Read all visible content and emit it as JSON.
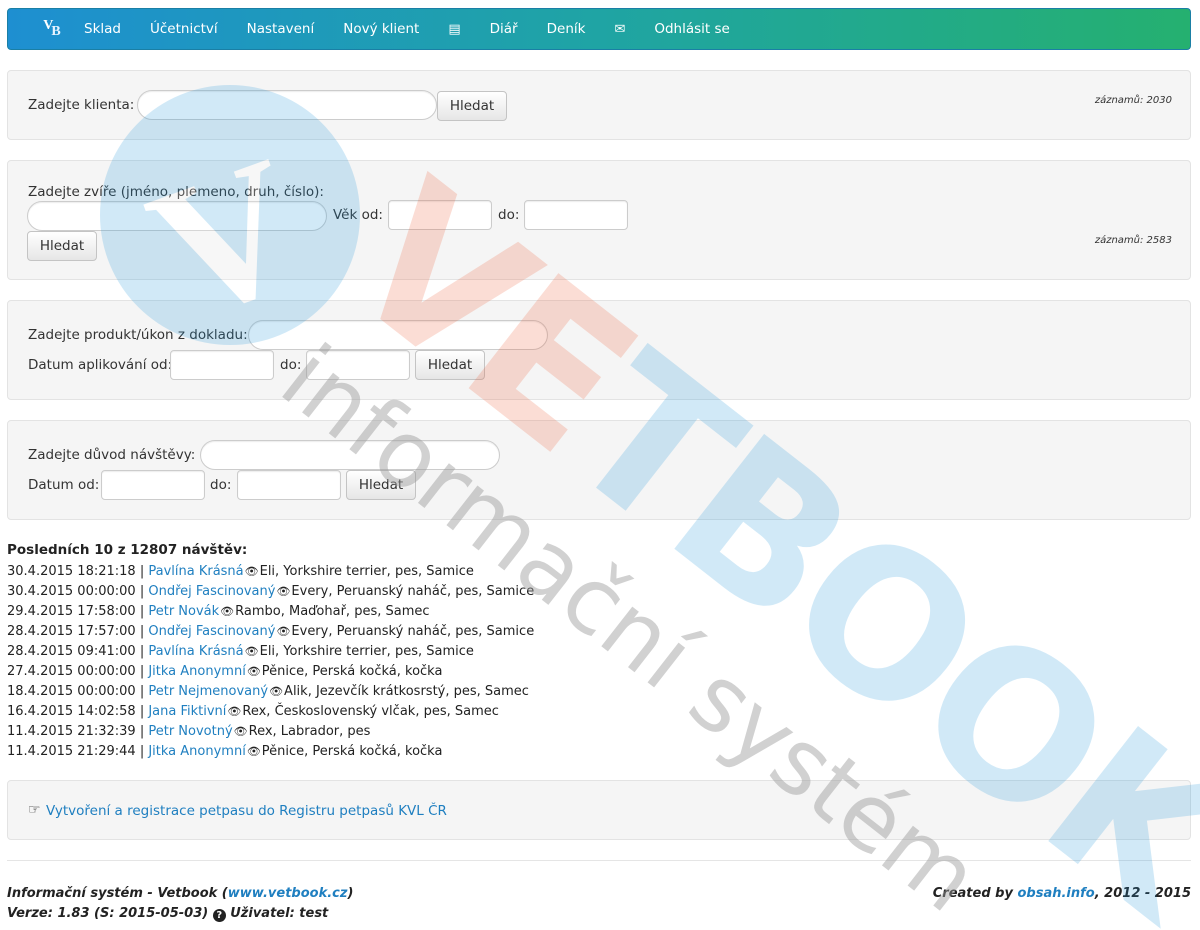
{
  "nav": {
    "logo": {
      "v": "V",
      "b": "B"
    },
    "items": [
      "Sklad",
      "Účetnictví",
      "Nastavení",
      "Nový klient"
    ],
    "items2": [
      "Diář",
      "Deník"
    ],
    "logout": "Odhlásit se",
    "icons": {
      "notebook": "notebook-icon",
      "envelope": "envelope-icon"
    },
    "notebook_glyph": "▤",
    "envelope_glyph": "✉"
  },
  "client_search": {
    "label": "Zadejte klienta:",
    "value": "",
    "button": "Hledat",
    "count": "záznamů: 2030"
  },
  "animal_search": {
    "label": "Zadejte zvíře (jméno, plemeno, druh, číslo):",
    "value": "",
    "age_from_label": "Věk od:",
    "age_to_label": "do:",
    "button": "Hledat",
    "count": "záznamů: 2583"
  },
  "product_search": {
    "label": "Zadejte produkt/úkon z dokladu:",
    "date_from_label": "Datum aplikování od:",
    "date_to_label": "do:",
    "button": "Hledat"
  },
  "reason_search": {
    "label": "Zadejte důvod návštěvy:",
    "date_from_label": "Datum od:",
    "date_to_label": "do:",
    "button": "Hledat"
  },
  "visits": {
    "title": "Posledních 10 z 12807 návštěv:",
    "rows": [
      {
        "datetime": "30.4.2015 18:21:18",
        "client": "Pavlína Krásná",
        "animal": "Eli, Yorkshire terrier, pes, Samice"
      },
      {
        "datetime": "30.4.2015 00:00:00",
        "client": "Ondřej Fascinovaný",
        "animal": "Every, Peruanský naháč, pes, Samice"
      },
      {
        "datetime": "29.4.2015 17:58:00",
        "client": "Petr Novák",
        "animal": "Rambo, Maďohař, pes, Samec"
      },
      {
        "datetime": "28.4.2015 17:57:00",
        "client": "Ondřej Fascinovaný",
        "animal": "Every, Peruanský naháč, pes, Samice"
      },
      {
        "datetime": "28.4.2015 09:41:00",
        "client": "Pavlína Krásná",
        "animal": "Eli, Yorkshire terrier, pes, Samice"
      },
      {
        "datetime": "27.4.2015 00:00:00",
        "client": "Jitka Anonymní",
        "animal": "Pěnice, Perská kočká, kočka"
      },
      {
        "datetime": "18.4.2015 00:00:00",
        "client": "Petr Nejmenovaný",
        "animal": "Alik, Jezevčík krátkosrstý, pes, Samec"
      },
      {
        "datetime": "16.4.2015 14:02:58",
        "client": "Jana Fiktivní",
        "animal": "Rex, Československý vlčak, pes, Samec"
      },
      {
        "datetime": "11.4.2015 21:32:39",
        "client": "Petr Novotný",
        "animal": "Rex, Labrador, pes"
      },
      {
        "datetime": "11.4.2015 21:29:44",
        "client": "Jitka Anonymní",
        "animal": "Pěnice, Perská kočká, kočka"
      }
    ]
  },
  "petpass": {
    "hand_icon": "pointing-hand-icon",
    "hand_glyph": "☞",
    "link": "Vytvoření a registrace petpasu do Registru petpasů KVL ČR"
  },
  "watermark": {
    "brand": "VETBOOK",
    "subtitle": "informační systém"
  },
  "footer": {
    "left_prefix": "Informační systém - Vetbook (",
    "left_link": "www.vetbook.cz",
    "left_suffix": ")",
    "version": "Verze: 1.83 (S: 2015-05-03)",
    "user": "Uživatel: test",
    "help_icon": "question-icon",
    "help_glyph": "?",
    "right_prefix": "Created by ",
    "right_link": "obsah.info",
    "right_suffix": ", 2012 - 2015"
  },
  "colors": {
    "link": "#1f7fc0",
    "nav_start": "#1e8fd1",
    "nav_end": "#25b070",
    "wm_blue": "#1e96dc",
    "wm_red": "#ee5a32",
    "wm_gray": "#9a9a9a"
  }
}
